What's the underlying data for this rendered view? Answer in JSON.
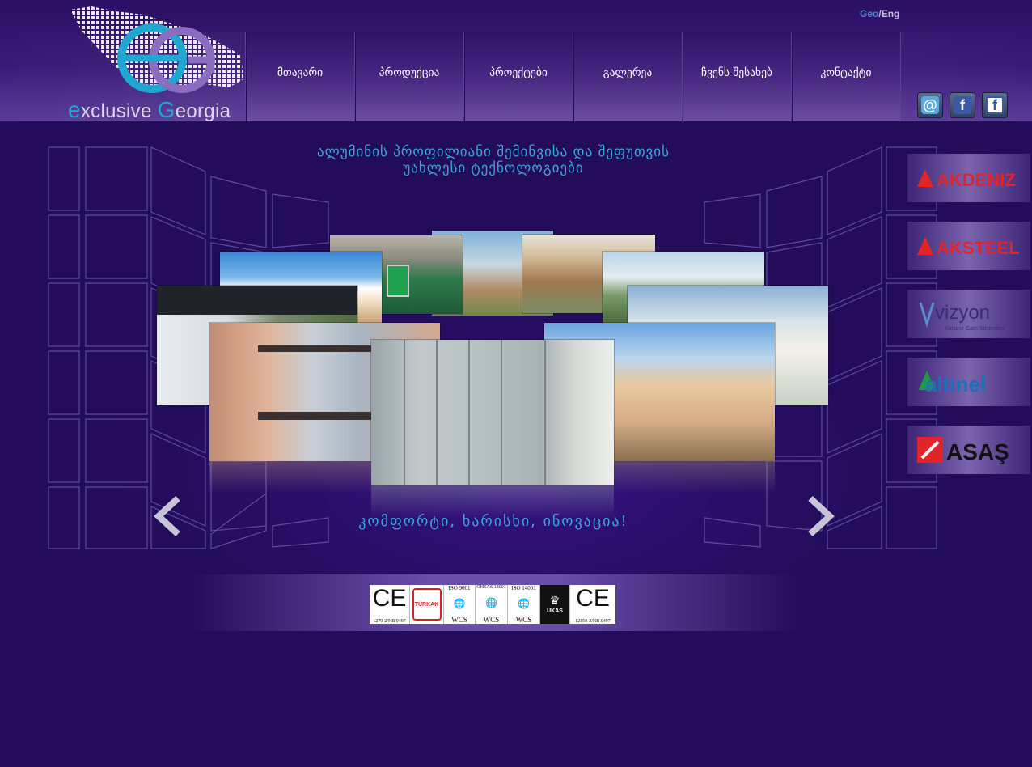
{
  "lang": {
    "geo": "Geo",
    "sep": "/",
    "eng": "Eng"
  },
  "logo": {
    "letter_e": "e",
    "word1": "xclusive ",
    "letter_g": "G",
    "word2": "eorgia"
  },
  "nav": [
    {
      "label": "მთავარი"
    },
    {
      "label": "პროდუქცია"
    },
    {
      "label": "პროექტები"
    },
    {
      "label": "გალერეა"
    },
    {
      "label": "ჩვენს შესახებ"
    },
    {
      "label": "კონტაქტი"
    }
  ],
  "social": [
    {
      "icon": "email-icon",
      "glyph": "@"
    },
    {
      "icon": "facebook-icon",
      "glyph": "f"
    },
    {
      "icon": "facebook-icon",
      "glyph": "f"
    }
  ],
  "headline": {
    "line1": "ალუმინის პროფილიანი შემინვისა და შეფუთვის",
    "line2": "უახლესი ტექნოლოგიები"
  },
  "slogan": "კომფორტი, ხარისხი, ინოვაცია!",
  "brands": [
    {
      "name": "AKDENIZ",
      "color": "#e2242a"
    },
    {
      "name": "AKSTEEL",
      "color": "#e2242a"
    },
    {
      "name": "vizyon",
      "tagline": "Katlanır Cam Sistemleri",
      "color": "#3a2b7a"
    },
    {
      "name": "altınel",
      "color": "#1c6fb8"
    },
    {
      "name": "ASAŞ",
      "color": "#111111"
    }
  ],
  "certs": [
    {
      "mark": "CE",
      "code": "1279-2/NB 0497"
    },
    {
      "mark": "TÜRKAK",
      "code": ""
    },
    {
      "mark": "ISO 9001",
      "code": "WCS"
    },
    {
      "mark": "OHSAS 18001",
      "code": "WCS"
    },
    {
      "mark": "ISO 14001",
      "code": "WCS"
    },
    {
      "mark": "UKAS",
      "code": ""
    },
    {
      "mark": "CE",
      "code": "12150-2/NB 0497"
    }
  ],
  "colors": {
    "background": "#230c5a",
    "accent": "#3aa6dc",
    "nav_text": "#ffffff"
  }
}
